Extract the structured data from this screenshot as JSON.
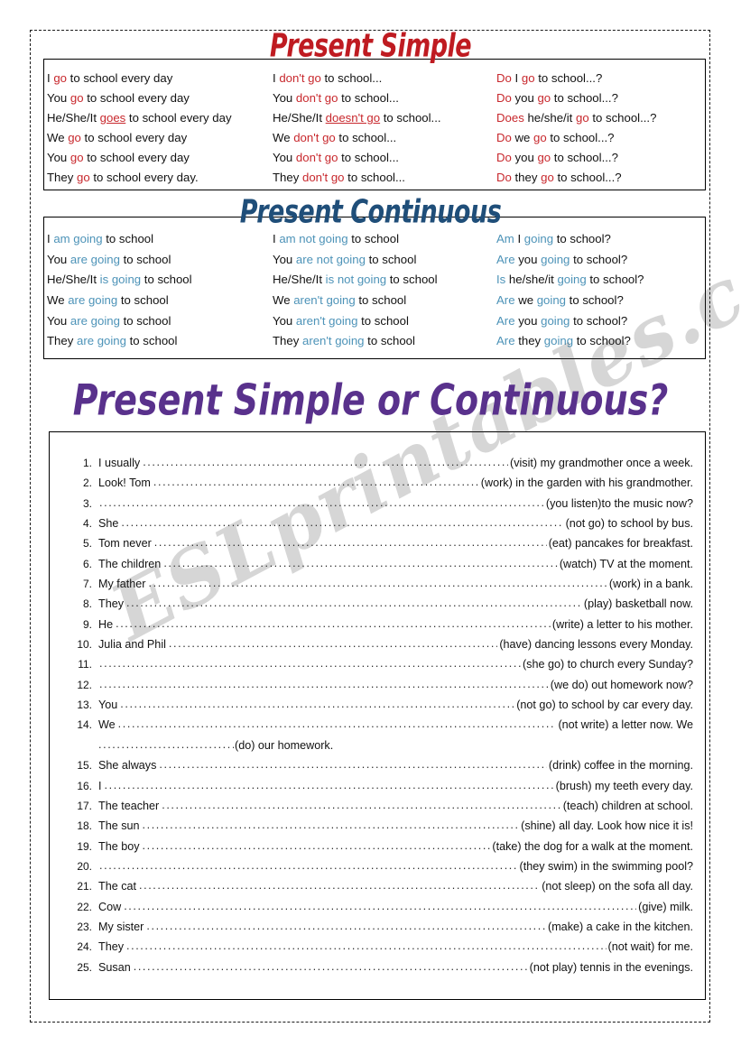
{
  "colors": {
    "red_accent": "#c8282d",
    "red_heading": "#bf1b21",
    "blue_accent": "#4d93b8",
    "blue_heading": "#1f4e79",
    "purple_title": "#59318c"
  },
  "watermark": {
    "text": "ESLprintables.com"
  },
  "sections": {
    "present_simple": {
      "heading": "Present Simple",
      "rows": [
        {
          "affirmative": {
            "pre": "I ",
            "hl": "go",
            "post": " to school every day",
            "underline": false
          },
          "negative": {
            "pre": "I ",
            "hl": "don't go",
            "post": " to school...",
            "underline": false
          },
          "question": {
            "pre": "",
            "hl1": "Do",
            "mid": " I ",
            "hl2": "go",
            "post": " to school...?"
          }
        },
        {
          "affirmative": {
            "pre": "You ",
            "hl": "go",
            "post": " to school every day",
            "underline": false
          },
          "negative": {
            "pre": "You ",
            "hl": "don't go",
            "post": " to school...",
            "underline": false
          },
          "question": {
            "pre": "",
            "hl1": "Do",
            "mid": " you ",
            "hl2": "go",
            "post": " to school...?"
          }
        },
        {
          "affirmative": {
            "pre": "He/She/It ",
            "hl": "goes",
            "post": " to school every day",
            "underline": true
          },
          "negative": {
            "pre": "He/She/It ",
            "hl": "doesn't go",
            "post": " to school...",
            "underline": true
          },
          "question": {
            "pre": "",
            "hl1": "Does",
            "mid": " he/she/it ",
            "hl2": "go",
            "post": " to school...?"
          }
        },
        {
          "affirmative": {
            "pre": "We ",
            "hl": "go",
            "post": " to school every day",
            "underline": false
          },
          "negative": {
            "pre": "We ",
            "hl": "don't go",
            "post": " to school...",
            "underline": false
          },
          "question": {
            "pre": "",
            "hl1": "Do",
            "mid": " we ",
            "hl2": "go",
            "post": " to school...?"
          }
        },
        {
          "affirmative": {
            "pre": "You ",
            "hl": "go",
            "post": " to school every day",
            "underline": false
          },
          "negative": {
            "pre": "You ",
            "hl": "don't go",
            "post": " to school...",
            "underline": false
          },
          "question": {
            "pre": "",
            "hl1": "Do",
            "mid": " you ",
            "hl2": "go",
            "post": " to school...?"
          }
        },
        {
          "affirmative": {
            "pre": "They ",
            "hl": "go",
            "post": " to school every day.",
            "underline": false
          },
          "negative": {
            "pre": "They ",
            "hl": "don't go",
            "post": " to school...",
            "underline": false
          },
          "question": {
            "pre": "",
            "hl1": "Do",
            "mid": " they ",
            "hl2": "go",
            "post": " to school...?"
          }
        }
      ]
    },
    "present_continuous": {
      "heading": "Present Continuous",
      "rows": [
        {
          "affirmative": {
            "pre": "I ",
            "hl": "am going",
            "post": " to school"
          },
          "negative": {
            "pre": "I ",
            "hl": "am not going",
            "post": " to school"
          },
          "question": {
            "pre": "",
            "hl1": "Am",
            "mid": " I ",
            "hl2": "going",
            "post": " to school?"
          }
        },
        {
          "affirmative": {
            "pre": "You ",
            "hl": "are going",
            "post": " to school"
          },
          "negative": {
            "pre": "You ",
            "hl": "are not going",
            "post": " to school"
          },
          "question": {
            "pre": "",
            "hl1": "Are",
            "mid": " you ",
            "hl2": "going",
            "post": " to school?"
          }
        },
        {
          "affirmative": {
            "pre": "He/She/It ",
            "hl": "is going",
            "post": " to school"
          },
          "negative": {
            "pre": "He/She/It ",
            "hl": "is not going",
            "post": " to school"
          },
          "question": {
            "pre": "",
            "hl1": "Is",
            "mid": " he/she/it ",
            "hl2": "going",
            "post": " to school?"
          }
        },
        {
          "affirmative": {
            "pre": "We ",
            "hl": "are going",
            "post": " to school"
          },
          "negative": {
            "pre": "We ",
            "hl": "aren't going",
            "post": " to school"
          },
          "question": {
            "pre": "",
            "hl1": "Are",
            "mid": " we ",
            "hl2": "going",
            "post": " to school?"
          }
        },
        {
          "affirmative": {
            "pre": "You ",
            "hl": "are going",
            "post": " to school"
          },
          "negative": {
            "pre": "You ",
            "hl": "aren't going",
            "post": " to school"
          },
          "question": {
            "pre": "",
            "hl1": "Are",
            "mid": " you ",
            "hl2": "going",
            "post": " to school?"
          }
        },
        {
          "affirmative": {
            "pre": "They ",
            "hl": "are going",
            "post": " to school"
          },
          "negative": {
            "pre": "They ",
            "hl": "aren't going",
            "post": " to school"
          },
          "question": {
            "pre": "",
            "hl1": "Are",
            "mid": " they ",
            "hl2": "going",
            "post": " to school?"
          }
        }
      ]
    }
  },
  "main_title": "Present Simple or Continuous?",
  "exercise": {
    "items": [
      {
        "num": "1.",
        "lead": "I usually",
        "tail": "(visit) my grandmother once a week."
      },
      {
        "num": "2.",
        "lead": "Look! Tom",
        "tail": "(work) in the garden with his grandmother."
      },
      {
        "num": "3.",
        "lead": "",
        "tail": "(you listen)to the music now?"
      },
      {
        "num": "4.",
        "lead": "She",
        "tail": "(not go) to school by bus."
      },
      {
        "num": "5.",
        "lead": "Tom never",
        "tail": "(eat) pancakes for breakfast."
      },
      {
        "num": "6.",
        "lead": "The children",
        "tail": "(watch) TV at the moment."
      },
      {
        "num": "7.",
        "lead": "My father",
        "tail": "(work) in a bank."
      },
      {
        "num": "8.",
        "lead": "They",
        "tail": "(play) basketball now."
      },
      {
        "num": "9.",
        "lead": "He",
        "tail": "(write) a letter to his mother."
      },
      {
        "num": "10.",
        "lead": "Julia and Phil",
        "tail": "(have) dancing lessons every Monday."
      },
      {
        "num": "11.",
        "lead": "",
        "tail": "(she go) to church every Sunday?"
      },
      {
        "num": "12.",
        "lead": "",
        "tail": "(we do) out homework now?"
      },
      {
        "num": "13.",
        "lead": "You",
        "tail": "(not go) to school by car every day."
      },
      {
        "num": "14.",
        "lead": "We",
        "tail": "(not write) a letter now. We",
        "continuation": "(do) our homework."
      },
      {
        "num": "15.",
        "lead": "She  always",
        "tail": "(drink) coffee in the morning."
      },
      {
        "num": "16.",
        "lead": "I",
        "tail": "(brush) my teeth every day."
      },
      {
        "num": "17.",
        "lead": "The teacher",
        "tail": "(teach) children at school."
      },
      {
        "num": "18.",
        "lead": "The sun",
        "tail": "(shine) all day. Look how nice it is!"
      },
      {
        "num": "19.",
        "lead": "The boy",
        "tail": "(take) the dog for a walk at the moment."
      },
      {
        "num": "20.",
        "lead": "",
        "tail": "(they swim) in the swimming pool?"
      },
      {
        "num": "21.",
        "lead": "The cat",
        "tail": "(not sleep) on the sofa all day."
      },
      {
        "num": "22.",
        "lead": "Cow",
        "tail": "(give) milk."
      },
      {
        "num": "23.",
        "lead": "My sister",
        "tail": "(make) a cake in the kitchen."
      },
      {
        "num": "24.",
        "lead": "They",
        "tail": "(not wait) for me."
      },
      {
        "num": "25.",
        "lead": "Susan",
        "tail": "(not play) tennis in the evenings."
      }
    ]
  }
}
